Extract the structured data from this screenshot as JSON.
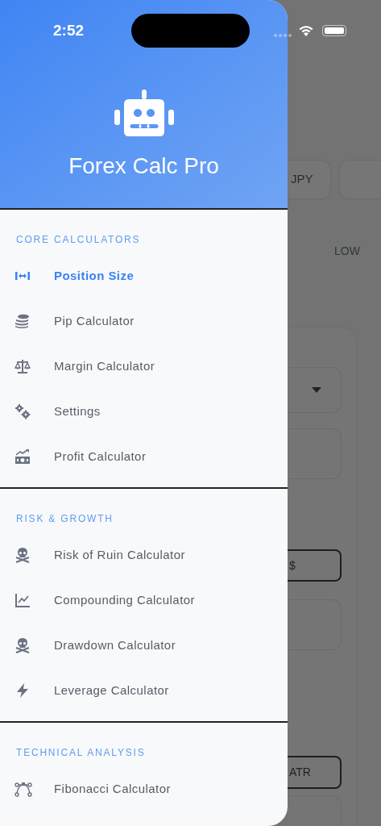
{
  "status_bar": {
    "time": "2:52"
  },
  "drawer": {
    "title": "Forex Calc Pro",
    "sections": [
      {
        "title": "CORE CALCULATORS",
        "items": [
          {
            "label": "Position Size",
            "kind": "arrows",
            "selected": true
          },
          {
            "label": "Pip Calculator",
            "kind": "coins",
            "selected": false
          },
          {
            "label": "Margin Calculator",
            "kind": "scale",
            "selected": false
          },
          {
            "label": "Settings",
            "kind": "gears",
            "selected": false
          },
          {
            "label": "Profit Calculator",
            "kind": "money",
            "selected": false
          }
        ]
      },
      {
        "title": "RISK & GROWTH",
        "items": [
          {
            "label": "Risk of Ruin Calculator",
            "kind": "skull",
            "selected": false
          },
          {
            "label": "Compounding Calculator",
            "kind": "chart",
            "selected": false
          },
          {
            "label": "Drawdown Calculator",
            "kind": "skull",
            "selected": false
          },
          {
            "label": "Leverage Calculator",
            "kind": "bolt",
            "selected": false
          }
        ]
      },
      {
        "title": "TECHNICAL ANALYSIS",
        "items": [
          {
            "label": "Fibonacci Calculator",
            "kind": "bezier",
            "selected": false
          }
        ]
      }
    ]
  },
  "background": {
    "chip": "JPY",
    "column_label": "LOW",
    "amount_suffix": "$",
    "indicator": "ATR"
  }
}
